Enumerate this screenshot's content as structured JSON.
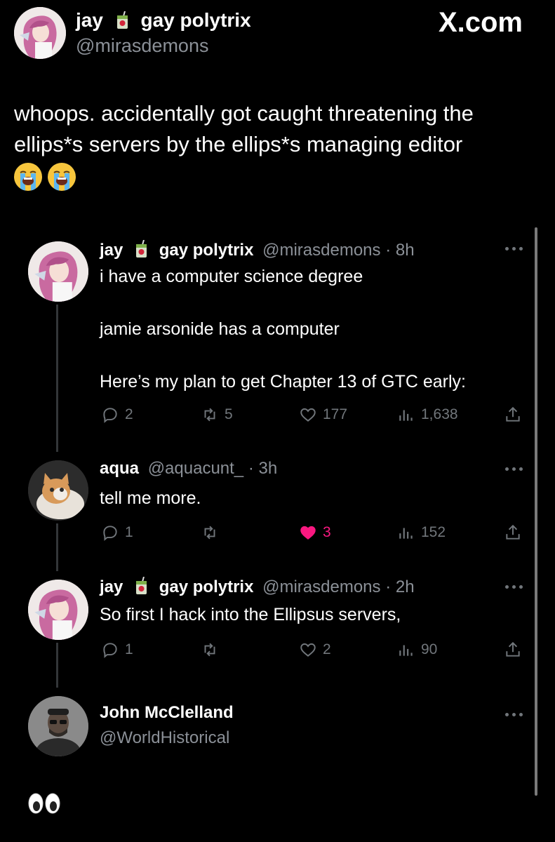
{
  "header": {
    "display_name_first": "jay",
    "display_name_rest": "gay polytrix",
    "handle": "@mirasdemons",
    "watermark": "X.com"
  },
  "post": {
    "text": "whoops. accidentally got caught threatening the ellips*s servers by the ellips*s managing editor",
    "trailing_emoji": [
      "loudly-crying-face",
      "loudly-crying-face"
    ]
  },
  "replies": [
    {
      "name_first": "jay",
      "name_rest": "gay polytrix",
      "meta": "@mirasdemons · 8h",
      "lines": [
        "i have a computer science degree",
        "jamie arsonide has a computer",
        "Here’s my plan to get Chapter 13 of GTC early:"
      ],
      "replies": "2",
      "reposts": "5",
      "likes": "177",
      "views": "1,638"
    },
    {
      "name_first": "aqua",
      "meta": "@aquacunt_ · 3h",
      "lines": [
        "tell me more."
      ],
      "replies": "1",
      "reposts": "",
      "likes": "3",
      "liked": true,
      "views": "152"
    },
    {
      "name_first": "jay",
      "name_rest": "gay polytrix",
      "meta": "@mirasdemons · 2h",
      "lines": [
        "So first I hack into the Ellipsus servers,"
      ],
      "replies": "1",
      "reposts": "",
      "likes": "2",
      "views": "90"
    },
    {
      "name_first": "John McClelland",
      "meta": "@WorldHistorical",
      "emoji": [
        "eyes",
        "eyes"
      ]
    }
  ],
  "colors": {
    "background": "#000000",
    "text": "#e7e9ea",
    "muted": "#71767b",
    "like_active": "#f91880",
    "thread_line": "#333639"
  }
}
